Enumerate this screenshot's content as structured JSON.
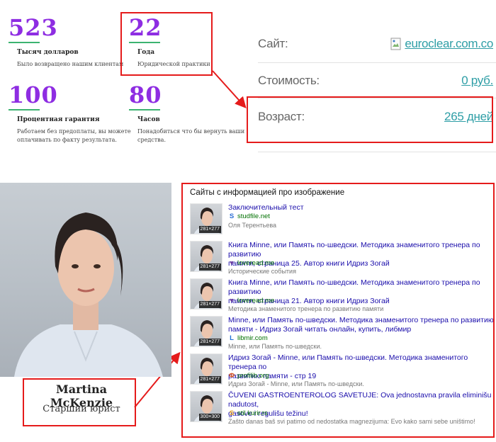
{
  "stats": [
    {
      "number": "523",
      "title": "Тысяч долларов",
      "desc": "Было возвращено нашим клиентам"
    },
    {
      "number": "22",
      "title": "Года",
      "desc": "Юридической практики"
    },
    {
      "number": "100",
      "title": "Процентная гарантия",
      "desc_line1": "Работаем без предоплаты, вы можете",
      "desc_line2": "оплачивать по факту результата."
    },
    {
      "number": "80",
      "title": "Часов",
      "desc_line1": "Понадобиться что бы вернуть ваши",
      "desc_line2": "средства."
    }
  ],
  "info": {
    "site_label": "Сайт:",
    "site_value": "euroclear.com.co",
    "cost_label": "Стоимость:",
    "cost_value": "0 руб.",
    "age_label": "Возраст:",
    "age_value": "265 дней"
  },
  "person": {
    "name": "Martina McKenzie",
    "role": "Старший юрист"
  },
  "sites_title": "Сайты с информацией про изображение",
  "sites": [
    {
      "title": "Заключительный тест",
      "domain": "studfile.net",
      "desc": "Оля Терентьева",
      "size": "281×277",
      "fav": "S"
    },
    {
      "title_line1": "Книга Minne, или Память по-шведски. Методика знаменитого тренера по развитию",
      "title_line2": "памяти, страница 25. Автор книги Идриз Зогай",
      "domain": "loveread.me",
      "desc": "Исторические события",
      "size": "281×277",
      "fav": "♥"
    },
    {
      "title_line1": "Книга Minne, или Память по-шведски. Методика знаменитого тренера по развитию",
      "title_line2": "памяти, страница 21. Автор книги Идриз Зогай",
      "domain": "loveread.me",
      "desc": "Методика знаменитого тренера по развитию памяти",
      "size": "281×277",
      "fav": "♥"
    },
    {
      "title_line1": "Minne, или Память по-шведски. Методика знаменитого тренера по развитию",
      "title_line2": "памяти - Идриз Зогай читать онлайн, купить, либмир",
      "domain": "libmir.com",
      "desc": "Minne, или Память по-шведски.",
      "size": "281×277",
      "fav": "L"
    },
    {
      "title_line1": "Идриз Зогай - Minne, или Память по-шведски. Методика знаменитого тренера по",
      "title_line2": "развитию памяти - стр 19",
      "domain": "profilib.org",
      "desc": "Идриз Зогай - Minne, или Память по-шведски.",
      "size": "281×277",
      "fav": "Ф"
    },
    {
      "title_line1": "ČUVENI GASTROENTEROLOG SAVETUJE: Ova jednostavna pravila eliminišu nadutost,",
      "title_line2": "gasove i regulišu težinu!",
      "domain": "stil.kurir.rs",
      "desc": "Zašto danas baš svi patimo od nedostatka magnezijuma: Evo kako sami sebe uništimo!",
      "size": "300×300",
      "fav": "S"
    }
  ],
  "colors": {
    "accent": "#8e2de2",
    "underline": "#3cb371",
    "link": "#2e9ea6",
    "highlight": "#e51b1b"
  }
}
